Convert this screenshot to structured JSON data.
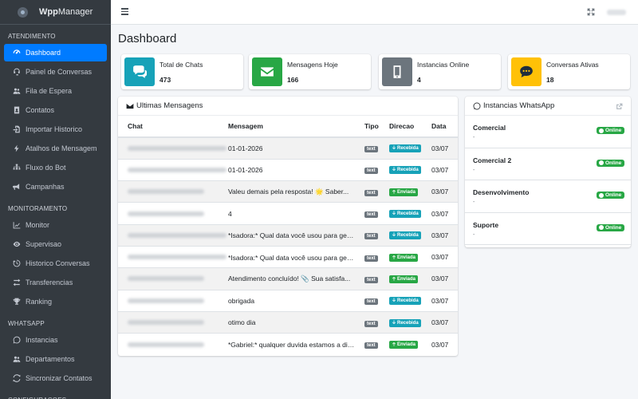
{
  "brand": {
    "bold": "Wpp",
    "rest": "Manager"
  },
  "sidebar": {
    "sections": [
      {
        "header": "ATENDIMENTO",
        "items": [
          {
            "label": "Dashboard",
            "icon": "dashboard-icon",
            "active": true
          },
          {
            "label": "Painel de Conversas",
            "icon": "headset-icon"
          },
          {
            "label": "Fila de Espera",
            "icon": "users-icon"
          },
          {
            "label": "Contatos",
            "icon": "address-book-icon"
          },
          {
            "label": "Importar Historico",
            "icon": "file-import-icon"
          },
          {
            "label": "Atalhos de Mensagem",
            "icon": "bolt-icon"
          },
          {
            "label": "Fluxo do Bot",
            "icon": "sitemap-icon"
          },
          {
            "label": "Campanhas",
            "icon": "bullhorn-icon"
          }
        ]
      },
      {
        "header": "MONITORAMENTO",
        "items": [
          {
            "label": "Monitor",
            "icon": "chart-line-icon"
          },
          {
            "label": "Supervisao",
            "icon": "eye-icon"
          },
          {
            "label": "Historico Conversas",
            "icon": "history-icon"
          },
          {
            "label": "Transferencias",
            "icon": "exchange-icon"
          },
          {
            "label": "Ranking",
            "icon": "trophy-icon"
          }
        ]
      },
      {
        "header": "WHATSAPP",
        "items": [
          {
            "label": "Instancias",
            "icon": "whatsapp-icon"
          },
          {
            "label": "Departamentos",
            "icon": "users-icon"
          },
          {
            "label": "Sincronizar Contatos",
            "icon": "sync-icon"
          }
        ]
      },
      {
        "header": "CONFIGURACOES",
        "items": []
      }
    ]
  },
  "page": {
    "title": "Dashboard"
  },
  "stats": [
    {
      "label": "Total de Chats",
      "value": "473",
      "icon": "comments-icon",
      "color": "#17a2b8"
    },
    {
      "label": "Mensagens Hoje",
      "value": "166",
      "icon": "envelope-icon",
      "color": "#28a745"
    },
    {
      "label": "Instancias Online",
      "value": "4",
      "icon": "mobile-icon",
      "color": "#6c757d"
    },
    {
      "label": "Conversas Ativas",
      "value": "18",
      "icon": "comment-dots-icon",
      "color": "#ffc107"
    }
  ],
  "messages_card": {
    "title": "Ultimas Mensagens",
    "columns": [
      "Chat",
      "Mensagem",
      "Tipo",
      "Direcao",
      "Data"
    ],
    "rows": [
      {
        "msg": "01-01-2026",
        "tipo": "text",
        "dir": "Recebida",
        "data": "03/07"
      },
      {
        "msg": "01-01-2026",
        "tipo": "text",
        "dir": "Recebida",
        "data": "03/07"
      },
      {
        "msg": "Valeu demais pela resposta! 🌟 Saber...",
        "tipo": "text",
        "dir": "Enviada",
        "data": "03/07"
      },
      {
        "msg": "4",
        "tipo": "text",
        "dir": "Recebida",
        "data": "03/07"
      },
      {
        "msg": "*Isadora:* Qual data você usou para gera...",
        "tipo": "text",
        "dir": "Recebida",
        "data": "03/07"
      },
      {
        "msg": "*Isadora:* Qual data você usou para gera...",
        "tipo": "text",
        "dir": "Enviada",
        "data": "03/07"
      },
      {
        "msg": "Atendimento concluído! 📎 Sua satisfa...",
        "tipo": "text",
        "dir": "Enviada",
        "data": "03/07"
      },
      {
        "msg": "obrigada",
        "tipo": "text",
        "dir": "Recebida",
        "data": "03/07"
      },
      {
        "msg": "otimo dia",
        "tipo": "text",
        "dir": "Recebida",
        "data": "03/07"
      },
      {
        "msg": "*Gabriel:* qualquer duvida estamos a dis...",
        "tipo": "text",
        "dir": "Enviada",
        "data": "03/07"
      }
    ]
  },
  "instances_card": {
    "title": "Instancias WhatsApp",
    "items": [
      {
        "name": "Comercial",
        "sub": "-",
        "status": "Online"
      },
      {
        "name": "Comercial 2",
        "sub": "-",
        "status": "Online"
      },
      {
        "name": "Desenvolvimento",
        "sub": "-",
        "status": "Online"
      },
      {
        "name": "Suporte",
        "sub": "-",
        "status": "Online"
      }
    ]
  }
}
